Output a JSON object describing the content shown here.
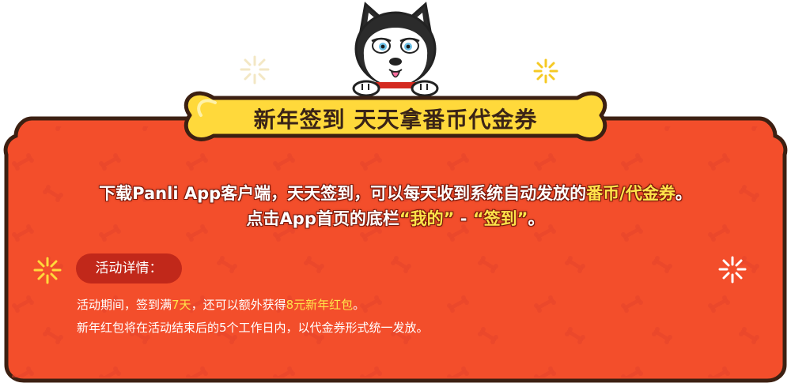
{
  "banner": {
    "title": "新年签到 天天拿番币代金券"
  },
  "intro": {
    "line1_prefix": "下载Panli App客户端，天天签到，可以每天收到系统自动发放的",
    "line1_highlight": "番币/代金券",
    "line1_suffix": "。",
    "line2_prefix": "点击App首页的底栏",
    "line2_tab1": "“我的”",
    "line2_sep": " - ",
    "line2_tab2": "“签到”",
    "line2_suffix": "。"
  },
  "details": {
    "label": "活动详情：",
    "line1_prefix": "活动期间，签到满",
    "line1_days": "7天",
    "line1_mid": "，还可以额外获得",
    "line1_reward": "8元新年红包",
    "line1_suffix": "。",
    "line2": "新年红包将在活动结束后的5个工作日内，以代金券形式统一发放。"
  },
  "colors": {
    "panel": "#f34e2b",
    "panel_border": "#3c2012",
    "bone": "#ffd93b",
    "highlight": "#ffe44a",
    "badge": "#c1281a"
  },
  "icons": [
    "husky-dog-mascot",
    "sparkle-icon",
    "bone-banner"
  ]
}
